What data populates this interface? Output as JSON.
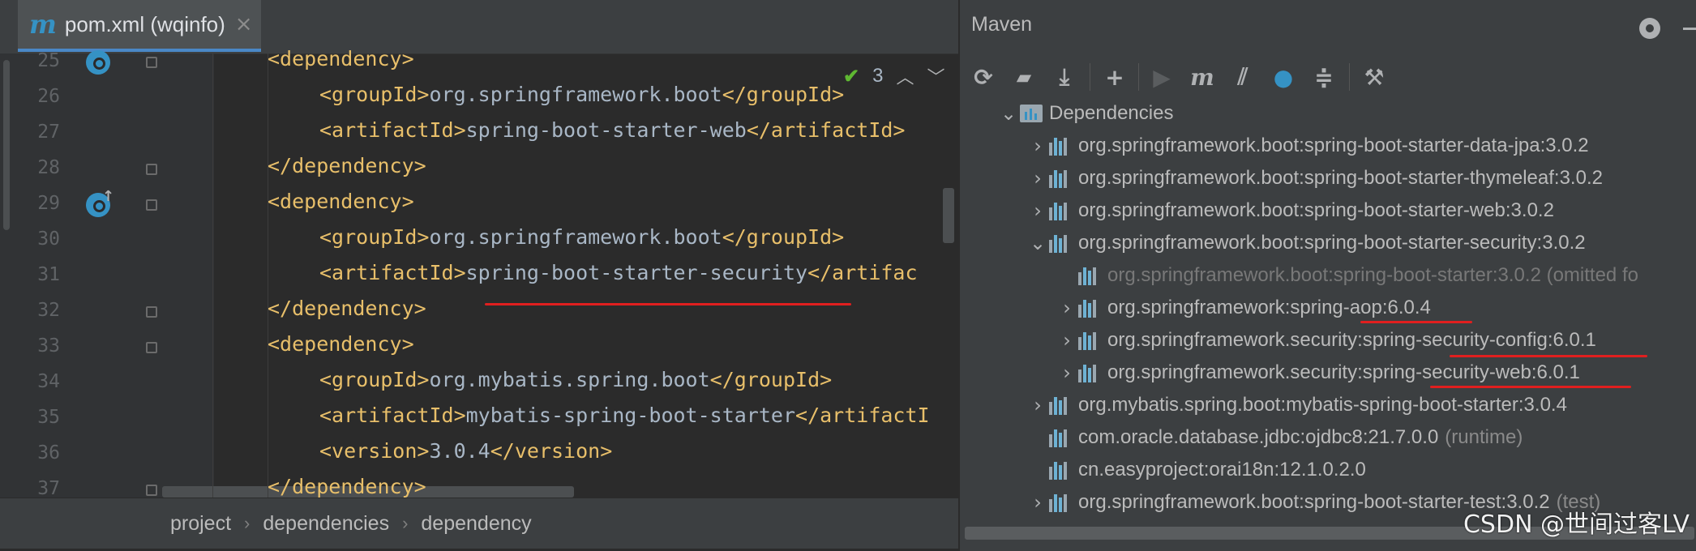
{
  "editor": {
    "tab": {
      "icon": "m",
      "title": "pom.xml (wqinfo)",
      "close": "×"
    },
    "inspection": {
      "count": "3"
    },
    "lines": [
      {
        "num": "25",
        "indent": 0,
        "parts": [
          [
            "tag",
            "<dependency>"
          ]
        ]
      },
      {
        "num": "26",
        "indent": 1,
        "parts": [
          [
            "tag",
            "<groupId>"
          ],
          [
            "txt",
            "org.springframework.boot"
          ],
          [
            "tag",
            "</groupId>"
          ]
        ]
      },
      {
        "num": "27",
        "indent": 1,
        "parts": [
          [
            "tag",
            "<artifactId>"
          ],
          [
            "txt",
            "spring-boot-starter-web"
          ],
          [
            "tag",
            "</artifactId>"
          ]
        ]
      },
      {
        "num": "28",
        "indent": 0,
        "parts": [
          [
            "tag",
            "</dependency>"
          ]
        ]
      },
      {
        "num": "29",
        "indent": 0,
        "parts": [
          [
            "tag",
            "<dependency>"
          ]
        ]
      },
      {
        "num": "30",
        "indent": 1,
        "parts": [
          [
            "tag",
            "<groupId>"
          ],
          [
            "txt",
            "org.springframework.boot"
          ],
          [
            "tag",
            "</groupId>"
          ]
        ]
      },
      {
        "num": "31",
        "indent": 1,
        "parts": [
          [
            "tag",
            "<artifactId>"
          ],
          [
            "txt",
            "spring-boot-starter-security"
          ],
          [
            "tag",
            "</artifac"
          ]
        ]
      },
      {
        "num": "32",
        "indent": 0,
        "parts": [
          [
            "tag",
            "</dependency>"
          ]
        ]
      },
      {
        "num": "33",
        "indent": 0,
        "parts": [
          [
            "tag",
            "<dependency>"
          ]
        ]
      },
      {
        "num": "34",
        "indent": 1,
        "parts": [
          [
            "tag",
            "<groupId>"
          ],
          [
            "txt",
            "org.mybatis.spring.boot"
          ],
          [
            "tag",
            "</groupId>"
          ]
        ]
      },
      {
        "num": "35",
        "indent": 1,
        "parts": [
          [
            "tag",
            "<artifactId>"
          ],
          [
            "txt",
            "mybatis-spring-boot-starter"
          ],
          [
            "tag",
            "</artifactI"
          ]
        ]
      },
      {
        "num": "36",
        "indent": 1,
        "parts": [
          [
            "tag",
            "<version>"
          ],
          [
            "txt",
            "3.0.4"
          ],
          [
            "tag",
            "</version>"
          ]
        ]
      },
      {
        "num": "37",
        "indent": 0,
        "parts": [
          [
            "tag",
            "</dependency>"
          ]
        ]
      }
    ],
    "breadcrumb": [
      "project",
      "dependencies",
      "dependency"
    ]
  },
  "maven": {
    "title": "Maven",
    "toolbar_icons": [
      "reload-icon",
      "generate-sources-icon",
      "download-icon",
      "add-icon",
      "run-icon",
      "execute-goal-icon",
      "toggle-offline-icon",
      "skip-tests-icon",
      "collapse-all-icon",
      "settings-wrench-icon"
    ],
    "tree": [
      {
        "level": 0,
        "expander": "open",
        "icon": "folder",
        "label": "Dependencies",
        "suffix": "",
        "dim": false
      },
      {
        "level": 1,
        "expander": "closed",
        "icon": "lib",
        "label": "org.springframework.boot:spring-boot-starter-data-jpa:3.0.2",
        "suffix": "",
        "dim": false
      },
      {
        "level": 1,
        "expander": "closed",
        "icon": "lib",
        "label": "org.springframework.boot:spring-boot-starter-thymeleaf:3.0.2",
        "suffix": "",
        "dim": false
      },
      {
        "level": 1,
        "expander": "closed",
        "icon": "lib",
        "label": "org.springframework.boot:spring-boot-starter-web:3.0.2",
        "suffix": "",
        "dim": false
      },
      {
        "level": 1,
        "expander": "open",
        "icon": "lib",
        "label": "org.springframework.boot:spring-boot-starter-security:3.0.2",
        "suffix": "",
        "dim": false
      },
      {
        "level": 2,
        "expander": "none",
        "icon": "lib",
        "label": "org.springframework.boot:spring-boot-starter:3.0.2 (omitted fo",
        "suffix": "",
        "dim": true
      },
      {
        "level": 2,
        "expander": "closed",
        "icon": "lib",
        "label": "org.springframework:spring-aop:6.0.4",
        "suffix": "",
        "dim": false
      },
      {
        "level": 2,
        "expander": "closed",
        "icon": "lib",
        "label": "org.springframework.security:spring-security-config:6.0.1",
        "suffix": "",
        "dim": false
      },
      {
        "level": 2,
        "expander": "closed",
        "icon": "lib",
        "label": "org.springframework.security:spring-security-web:6.0.1",
        "suffix": "",
        "dim": false
      },
      {
        "level": 1,
        "expander": "closed",
        "icon": "lib",
        "label": "org.mybatis.spring.boot:mybatis-spring-boot-starter:3.0.4",
        "suffix": "",
        "dim": false
      },
      {
        "level": 1,
        "expander": "none",
        "icon": "lib",
        "label": "com.oracle.database.jdbc:ojdbc8:21.7.0.0",
        "suffix": "(runtime)",
        "dim": false
      },
      {
        "level": 1,
        "expander": "none",
        "icon": "lib",
        "label": "cn.easyproject:orai18n:12.1.0.2.0",
        "suffix": "",
        "dim": false
      },
      {
        "level": 1,
        "expander": "closed",
        "icon": "lib",
        "label": "org.springframework.boot:spring-boot-starter-test:3.0.2",
        "suffix": "(test)",
        "dim": false
      }
    ]
  },
  "watermark": "CSDN @世间过客LV",
  "colors": {
    "tag": "#e8bf6a",
    "text": "#a9b7c6",
    "accent": "#3592c4",
    "annotation": "#e01f1f"
  }
}
